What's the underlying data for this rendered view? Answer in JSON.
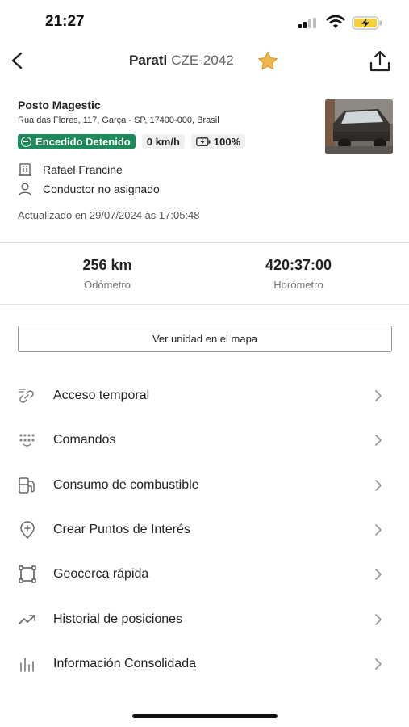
{
  "status_bar": {
    "time": "21:27",
    "icons": [
      "signal-icon",
      "wifi-icon",
      "battery-charging-icon"
    ]
  },
  "header": {
    "vehicle_name": "Parati",
    "plate": "CZE-2042",
    "icons": [
      "back-chevron-icon",
      "star-icon",
      "share-icon"
    ]
  },
  "location": {
    "name": "Posto Magestic",
    "address": "Rua das Flores, 117, Garça - SP, 17400-000, Brasil"
  },
  "status": {
    "engine": "Encedido Detenido",
    "speed": "0 km/h",
    "battery": "100%"
  },
  "owner": "Rafael Francine",
  "driver": "Conductor no asignado",
  "updated": "Actualizado en 29/07/2024 às 17:05:48",
  "stats": {
    "odometer_value": "256 km",
    "odometer_label": "Odómetro",
    "hourmeter_value": "420:37:00",
    "hourmeter_label": "Horómetro"
  },
  "map_button": "Ver unidad en el mapa",
  "menu": [
    {
      "label": "Acceso temporal",
      "icon": "link-icon"
    },
    {
      "label": "Comandos",
      "icon": "keypad-icon"
    },
    {
      "label": "Consumo de combustible",
      "icon": "fuel-icon"
    },
    {
      "label": "Crear Puntos de Interés",
      "icon": "map-pin-plus-icon"
    },
    {
      "label": "Geocerca rápida",
      "icon": "geofence-icon"
    },
    {
      "label": "Historial de posiciones",
      "icon": "trending-icon"
    },
    {
      "label": "Información Consolidada",
      "icon": "bar-chart-icon"
    }
  ],
  "colors": {
    "engine_badge": "#1d8a5b",
    "star": "#f2b84b",
    "text": "#1f1f1f"
  }
}
